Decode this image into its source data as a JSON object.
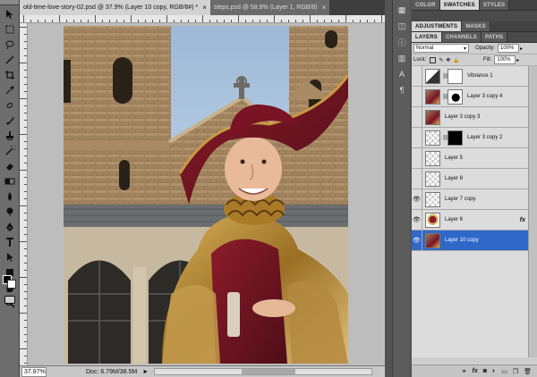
{
  "document_tabs": [
    {
      "label": "old-time-love-story-02.psd @ 37.9% (Layer 10 copy, RGB/8#) *",
      "close": "×",
      "active": true
    },
    {
      "label": "steps.psd @ 58.9% (Layer 1, RGB/8)",
      "close": "×",
      "active": false
    }
  ],
  "status": {
    "zoom": "37.87%",
    "doc": "Doc: 6.79M/38.5M",
    "arrow": "►"
  },
  "panel_top": {
    "tabs": [
      "COLOR",
      "SWATCHES",
      "STYLES"
    ],
    "active": "SWATCHES"
  },
  "panel_mid": {
    "tabs": [
      "ADJUSTMENTS",
      "MASKS"
    ],
    "active": "ADJUSTMENTS"
  },
  "layers_panel": {
    "tabs": [
      "LAYERS",
      "CHANNELS",
      "PATHS"
    ],
    "active": "LAYERS",
    "blend_mode": "Normal",
    "opacity_label": "Opacity:",
    "opacity_value": "100%",
    "lock_label": "Lock:",
    "fill_label": "Fill:",
    "fill_value": "100%",
    "layers": [
      {
        "name": "Vibrance 1",
        "visible": false,
        "thumb": "adjustment",
        "mask": "white",
        "fx": false,
        "selected": false
      },
      {
        "name": "Layer 3 copy 4",
        "visible": false,
        "thumb": "photo",
        "mask": "figure",
        "fx": false,
        "selected": false
      },
      {
        "name": "Layer 3 copy 3",
        "visible": false,
        "thumb": "photo",
        "mask": "",
        "fx": false,
        "selected": false
      },
      {
        "name": "Layer 3 copy 2",
        "visible": false,
        "thumb": "transparent",
        "mask": "black",
        "fx": false,
        "selected": false
      },
      {
        "name": "Layer 5",
        "visible": false,
        "thumb": "transparent",
        "mask": "",
        "fx": false,
        "selected": false
      },
      {
        "name": "Layer 8",
        "visible": false,
        "thumb": "transparent",
        "mask": "",
        "fx": false,
        "selected": false
      },
      {
        "name": "Layer 7 copy",
        "visible": true,
        "thumb": "transparent",
        "mask": "",
        "fx": false,
        "selected": false
      },
      {
        "name": "Layer 6",
        "visible": true,
        "thumb": "figure",
        "mask": "",
        "fx": true,
        "selected": false
      },
      {
        "name": "Layer 10 copy",
        "visible": true,
        "thumb": "photo",
        "mask": "",
        "fx": false,
        "selected": true
      }
    ],
    "fx_label": "fx",
    "eye_glyph": "👁",
    "footer_icons": [
      "link-layers-icon",
      "fx-icon",
      "add-mask-icon",
      "adjustment-layer-icon",
      "new-group-icon",
      "new-layer-icon",
      "trash-icon"
    ]
  },
  "colors": {
    "selected_layer": "#2f68c9",
    "ui_dark": "#535353",
    "canvas_bg": "#bdbdbd"
  }
}
